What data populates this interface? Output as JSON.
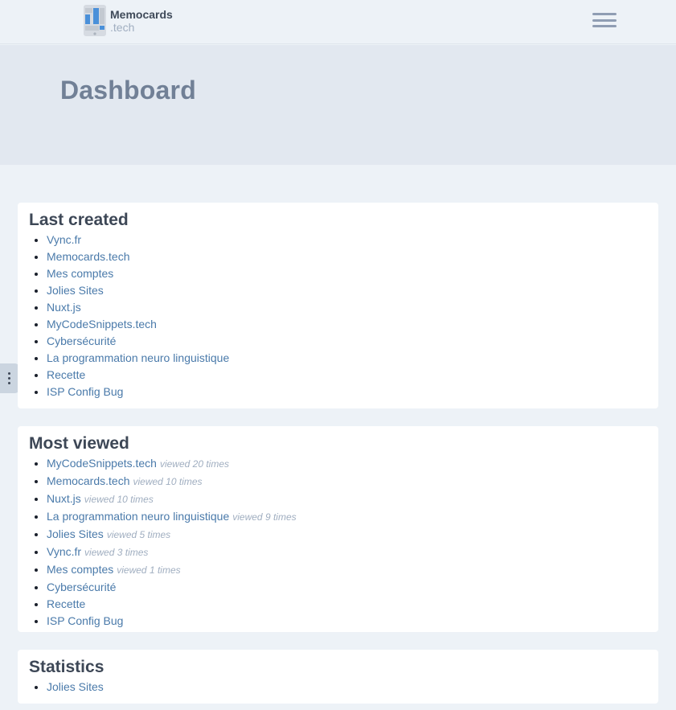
{
  "header": {
    "logo_line1": "Memocards",
    "logo_line2": ".tech"
  },
  "hero": {
    "title": "Dashboard"
  },
  "last_created": {
    "title": "Last created",
    "items": [
      "Vync.fr",
      "Memocards.tech",
      "Mes comptes",
      "Jolies Sites",
      "Nuxt.js",
      "MyCodeSnippets.tech",
      "Cybersécurité",
      "La programmation neuro linguistique",
      "Recette",
      "ISP Config Bug"
    ]
  },
  "most_viewed": {
    "title": "Most viewed",
    "items": [
      {
        "label": "MyCodeSnippets.tech",
        "views": "viewed 20 times"
      },
      {
        "label": "Memocards.tech",
        "views": "viewed 10 times"
      },
      {
        "label": "Nuxt.js",
        "views": "viewed 10 times"
      },
      {
        "label": "La programmation neuro linguistique",
        "views": "viewed 9 times"
      },
      {
        "label": "Jolies Sites",
        "views": "viewed 5 times"
      },
      {
        "label": "Vync.fr",
        "views": "viewed 3 times"
      },
      {
        "label": "Mes comptes",
        "views": "viewed 1 times"
      },
      {
        "label": "Cybersécurité",
        "views": ""
      },
      {
        "label": "Recette",
        "views": ""
      },
      {
        "label": "ISP Config Bug",
        "views": ""
      }
    ]
  },
  "statistics": {
    "title": "Statistics",
    "items": [
      "Jolies Sites"
    ]
  },
  "colors": {
    "background": "#edf2f7",
    "hero": "#e2e8f0",
    "link": "#4a7aaa",
    "muted": "#a0aec0",
    "logo_blue": "#4a90d9"
  }
}
